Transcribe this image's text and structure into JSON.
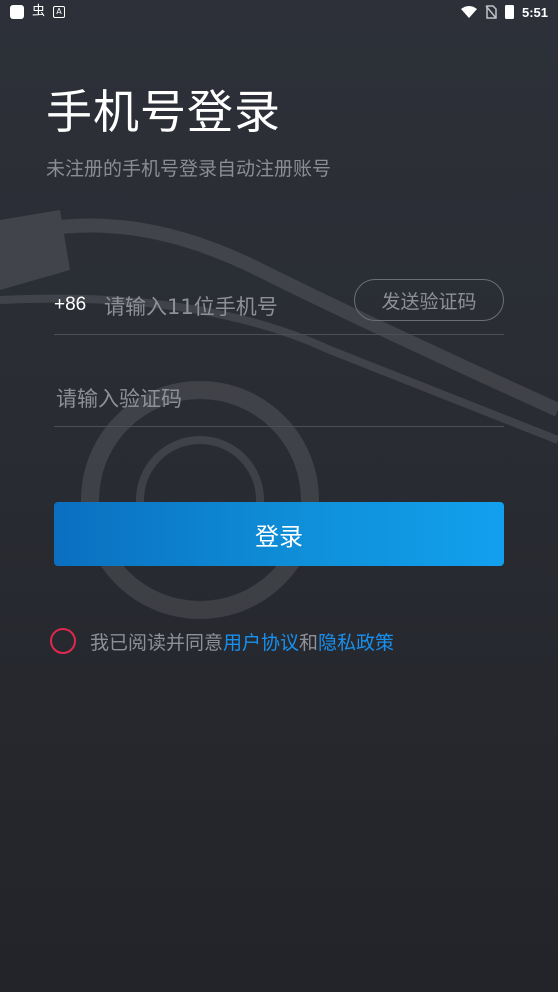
{
  "status_bar": {
    "app_icon_glyph": "虫",
    "mini_icon_glyph": "A",
    "time": "5:51",
    "icons": [
      "square-app-icon",
      "bug-icon",
      "a-badge-icon",
      "wifi-icon",
      "no-sim-icon",
      "battery-icon"
    ]
  },
  "header": {
    "title": "手机号登录",
    "subtitle": "未注册的手机号登录自动注册账号"
  },
  "form": {
    "country_code": "+86",
    "phone_placeholder": "请输入11位手机号",
    "phone_value": "",
    "send_code_label": "发送验证码",
    "code_placeholder": "请输入验证码",
    "code_value": "",
    "login_label": "登录"
  },
  "agreement": {
    "checked": false,
    "prefix": "我已阅读并同意",
    "user_agreement": "用户协议",
    "conjunction": "和",
    "privacy_policy": "隐私政策"
  },
  "colors": {
    "accent": "#1890ee",
    "button_gradient_start": "#0b6fc0",
    "button_gradient_end": "#12a0ee",
    "checkbox_border": "#e0284e",
    "background": "#2a2d34"
  }
}
